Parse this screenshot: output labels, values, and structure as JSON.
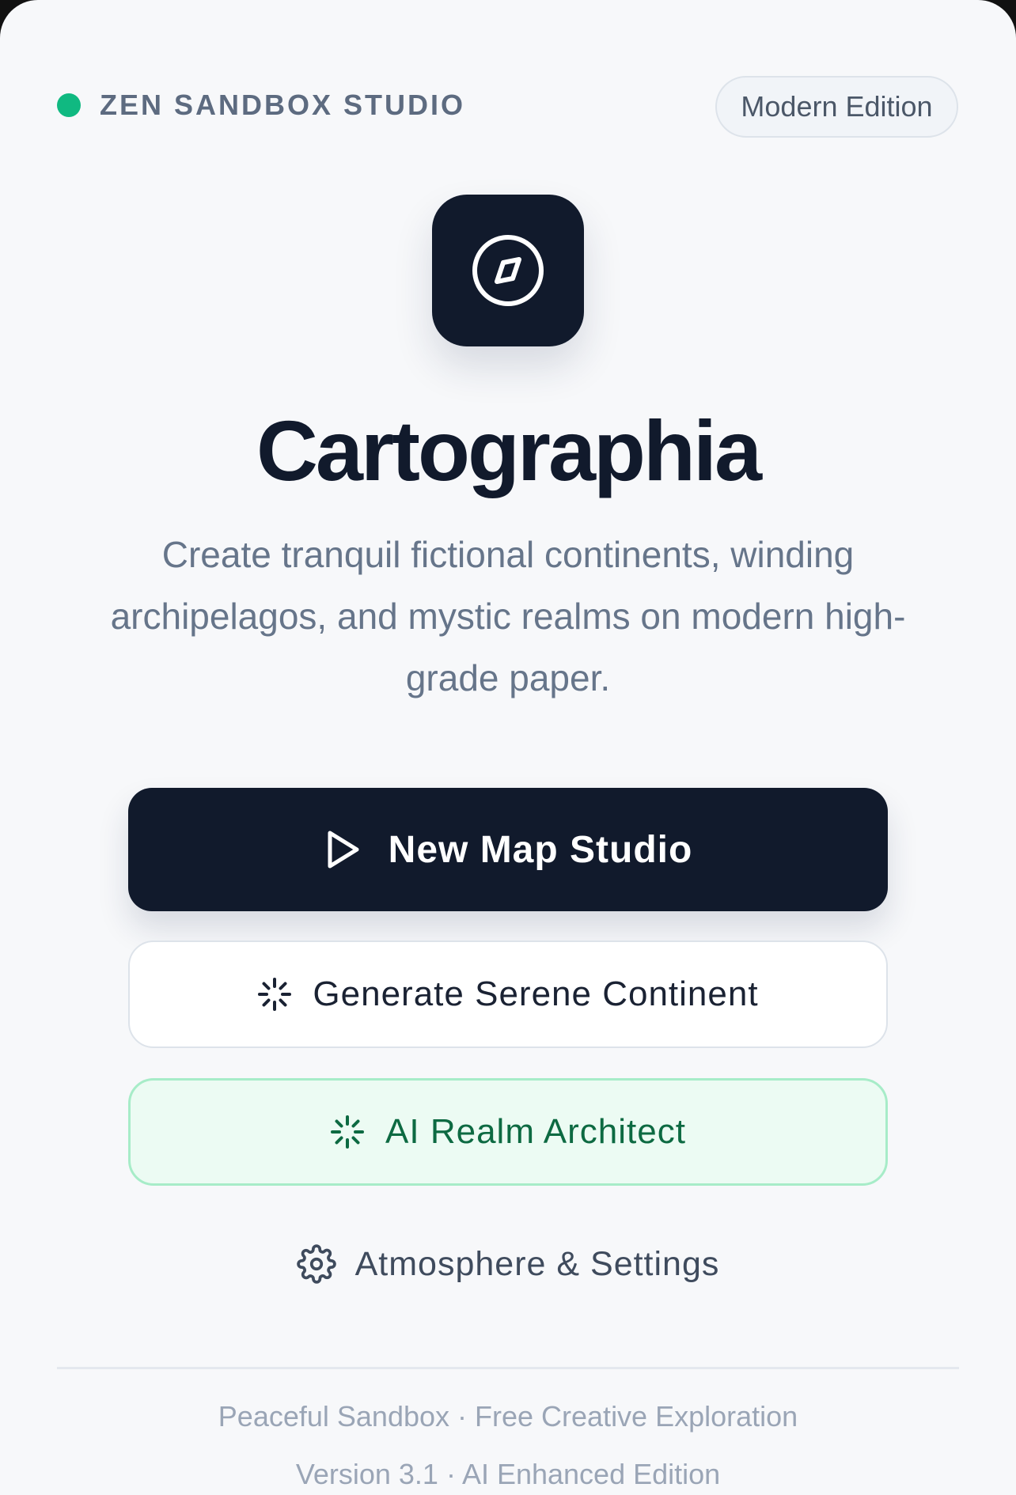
{
  "header": {
    "brand": "ZEN SANDBOX STUDIO",
    "edition_badge": "Modern Edition"
  },
  "hero": {
    "app_icon": "compass-icon",
    "title": "Cartographia",
    "subtitle": "Create tranquil fictional continents, winding archipelagos, and mystic realms on modern high-grade paper."
  },
  "actions": {
    "primary": {
      "label": "New Map Studio",
      "icon": "play-icon"
    },
    "secondary": {
      "label": "Generate Serene Continent",
      "icon": "loader-icon"
    },
    "ai": {
      "label": "AI Realm Architect",
      "icon": "loader-icon"
    },
    "settings": {
      "label": "Atmosphere & Settings",
      "icon": "gear-icon"
    }
  },
  "footer": {
    "line1": "Peaceful Sandbox · Free Creative Exploration",
    "line2": "Version 3.1 · AI Enhanced Edition"
  },
  "colors": {
    "status_dot": "#10b981",
    "primary": "#111a2c",
    "background": "#f7f8fa",
    "ai_accent": "#0d6a42",
    "ai_background": "#ecfbf3"
  }
}
